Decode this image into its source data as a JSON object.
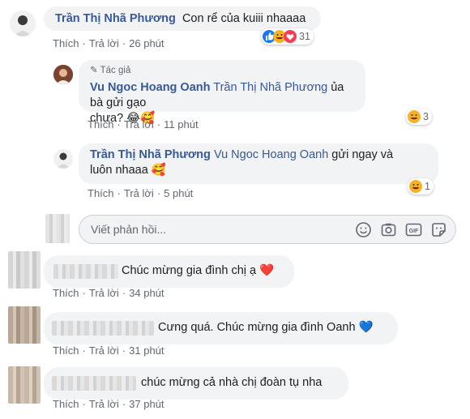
{
  "comment1": {
    "name": "Trần Thị Nhã Phương",
    "text": "Con rể của kuiii nhaaaa",
    "actions": [
      "Thích",
      "Trả lời",
      "26 phút"
    ],
    "reaction_count": "31",
    "reaction_icons": [
      "like-icon",
      "haha-icon",
      "love-icon"
    ]
  },
  "reply1": {
    "author_badge": "Tác giả",
    "name": "Vu Ngoc Hoang Oanh",
    "mention": "Trần Thị Nhã Phương",
    "text_a": " ủa bà gửi gạo",
    "text_b": "chưa? 😂🥰",
    "actions": [
      "Thích",
      "Trả lời",
      "11 phút"
    ],
    "reaction_count": "3"
  },
  "reply2": {
    "name": "Trần Thị Nhã Phương",
    "mention": "Vu Ngoc Hoang Oanh",
    "text_a": " gửi ngay và",
    "text_b": "luôn nhaaa 🥰",
    "actions": [
      "Thích",
      "Trả lời",
      "5 phút"
    ],
    "reaction_count": "1"
  },
  "reply_input": {
    "placeholder": "Viết phản hồi...",
    "icons": [
      "emoji-icon",
      "camera-icon",
      "gif-icon",
      "sticker-icon"
    ]
  },
  "comment2": {
    "text": "Chúc mừng gia đình chị ạ ❤️",
    "actions": [
      "Thích",
      "Trả lời",
      "34 phút"
    ]
  },
  "comment3": {
    "text": "Cưng quá. Chúc mừng gia đình Oanh 💙",
    "actions": [
      "Thích",
      "Trả lời",
      "31 phút"
    ]
  },
  "comment4": {
    "text": "chúc mừng cả nhà chị đoàn tụ nha",
    "actions": [
      "Thích",
      "Trả lời",
      "37 phút"
    ]
  },
  "colors": {
    "name_blue": "#385898",
    "bubble_bg": "#f2f3f5",
    "meta_gray": "#616770"
  }
}
